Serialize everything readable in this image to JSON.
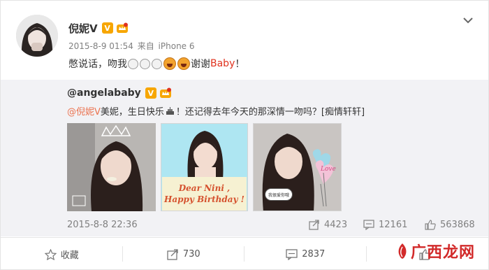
{
  "post": {
    "author": "倪妮V",
    "verified_badge": "V",
    "meta": {
      "date": "2015-8-9 01:54",
      "from": "来自",
      "device": "iPhone 6"
    },
    "text_before": "憋说话，吻我",
    "text_after": "谢谢",
    "text_highlight": "Baby",
    "text_end": "！",
    "emoji_icons": [
      "blank-face-icon",
      "blank-face-icon",
      "blank-face-icon",
      "laughing-face-icon",
      "laughing-face-icon"
    ]
  },
  "repost": {
    "author": "@angelababy",
    "verified_badge": "V",
    "mention": "@倪妮V",
    "text_part1": " 美妮，生日快乐",
    "text_part2": "！还记得去年今天的那深情一吻吗？[痴情轩轩]",
    "photo3_caption": "Dear Nini , Happy Birthday !",
    "photo3_caption_line1": "Dear Nini ,",
    "photo3_caption_line2": "Happy Birthday !",
    "photo4_bubble": "我很爱你哦",
    "photo4_heart_text": "Love",
    "date": "2015-8-8 22:36",
    "stats": {
      "reposts": "4423",
      "comments": "12161",
      "likes": "563868"
    }
  },
  "actions": {
    "favorite": "收藏",
    "repost": "730",
    "comment": "2837",
    "like": ""
  },
  "watermark": {
    "text": "广西龙网"
  },
  "colors": {
    "mention": "#eb7350",
    "highlight": "#e0321e",
    "badge": "#f7a600",
    "repost_bg": "#f2f2f5"
  }
}
